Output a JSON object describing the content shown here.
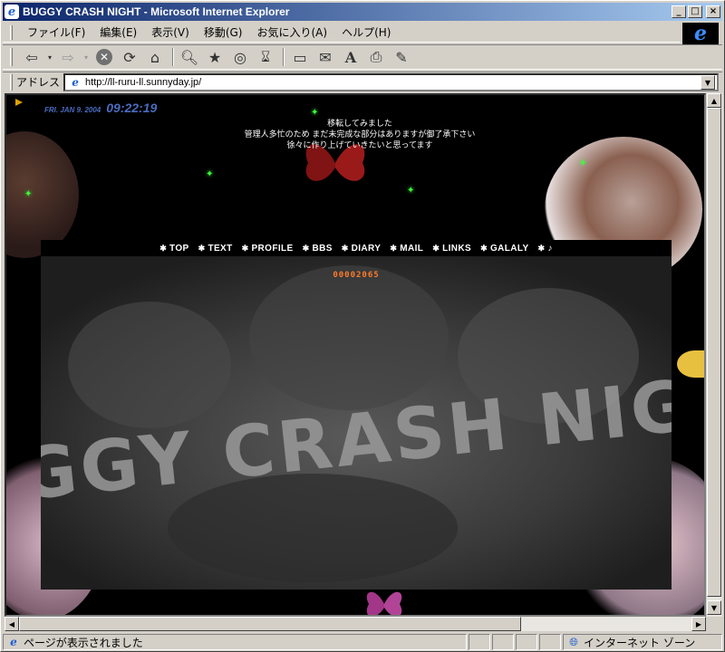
{
  "window": {
    "title": "BUGGY CRASH NIGHT - Microsoft Internet Explorer",
    "minimize": "_",
    "maximize": "□",
    "close": "×"
  },
  "menu": {
    "items": [
      "ファイル(F)",
      "編集(E)",
      "表示(V)",
      "移動(G)",
      "お気に入り(A)",
      "ヘルプ(H)"
    ]
  },
  "address": {
    "label": "アドレス",
    "url": "http://ll-ruru-ll.sunnyday.jp/"
  },
  "page": {
    "clock": {
      "date": "FRI. JAN 9. 2004",
      "time": "09:22:19"
    },
    "notice": [
      "移転してみました",
      "管理人多忙のため まだ未完成な部分はありますが御了承下さい",
      "徐々に作り上げていきたいと思ってます"
    ],
    "nav": [
      "TOP",
      "TEXT",
      "PROFILE",
      "BBS",
      "DIARY",
      "MAIL",
      "LINKS",
      "GALALY",
      "♪"
    ],
    "counter": "00002065",
    "title_art": "BUGGY CRASH NIGHT"
  },
  "status": {
    "text": "ページが表示されました",
    "zone": "インターネット ゾーン"
  },
  "colors": {
    "titlebar_start": "#0a246a",
    "titlebar_end": "#a6caf0",
    "counter": "#ff7a2a",
    "clock": "#4a6bbf",
    "star": "#3cff3c"
  }
}
